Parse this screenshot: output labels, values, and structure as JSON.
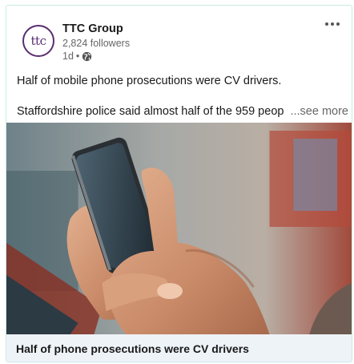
{
  "post": {
    "author": {
      "logo_text": "ttc",
      "name": "TTC Group",
      "followers": "2,824 followers",
      "age": "1d",
      "separator": "•",
      "visibility_icon": "globe-icon"
    },
    "more_icon": "ellipsis-icon",
    "text_line1": "Half of mobile phone prosecutions were CV drivers.",
    "text_line2": "Staffordshire police said almost half of the 959 peop",
    "see_more": "...see more",
    "image_alt": "hands-holding-smartphone-photo",
    "article_title": "Half of phone prosecutions were CV drivers"
  },
  "colors": {
    "brand": "#5a2d6e",
    "card_border": "#c9ece2",
    "caption_bg": "#eef3f8",
    "muted_text": "#666666"
  }
}
